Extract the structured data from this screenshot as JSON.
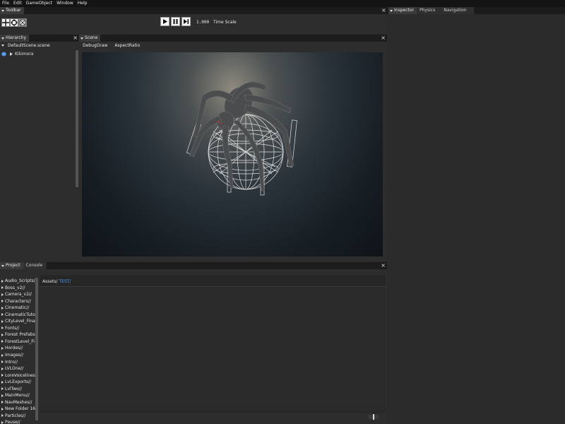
{
  "menu": [
    "File",
    "Edit",
    "GameObject",
    "Window",
    "Help"
  ],
  "toolbar": {
    "tab": "Toolbar",
    "time_scale_value": "1.000",
    "time_scale_label": "Time Scale"
  },
  "hierarchy": {
    "tab": "Hierarchy",
    "scene_name": "DefaultScene.scene",
    "node": "Kikimora"
  },
  "scene": {
    "tab": "Scene",
    "options": [
      "DebugDraw",
      "AspectRatio"
    ]
  },
  "inspector": {
    "tabs": [
      "Inspector",
      "Physics",
      "Navigation"
    ]
  },
  "project": {
    "tabs": [
      "Project",
      "Console"
    ],
    "path_root": "Assets/",
    "path_sub": "TEST/",
    "folders": [
      "Audio_Scripts/",
      "Boss_v2//",
      "Camera_v2//",
      "Characters//",
      "Cinematic//",
      "CinematicTutor",
      "CityLevel_Fina",
      "Fonts//",
      "Forest Prefabs",
      "ForestLevel_Fi",
      "Hordes//",
      "Images//",
      "Intro//",
      "LVLOne//",
      "LoreVoicelines",
      "LvLExports//",
      "LvlTwo//",
      "MainMenu//",
      "NavMeshes//",
      "New Folder 16/",
      "Particles//",
      "Pause//"
    ]
  },
  "colors": {
    "accent_link": "#4aa3ff",
    "panel_bg": "#2d2d2d",
    "titlebar_bg": "#1c1c1c"
  }
}
